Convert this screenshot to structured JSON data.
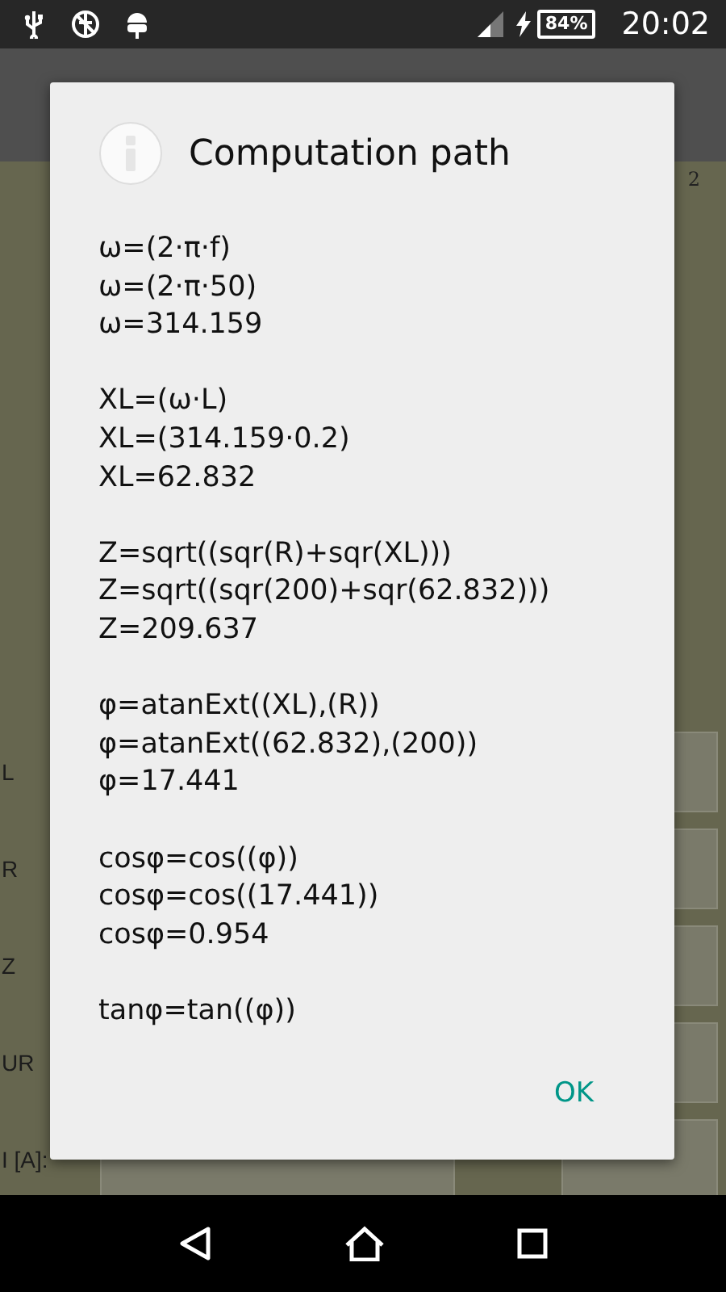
{
  "status_bar": {
    "battery": "84%",
    "time": "20:02"
  },
  "background": {
    "superscript": "2",
    "rows": [
      {
        "label": "L"
      },
      {
        "label": "R"
      },
      {
        "label": "Z"
      },
      {
        "label": "UR"
      },
      {
        "label": "I [A]:"
      }
    ]
  },
  "dialog": {
    "title": "Computation path",
    "groups": [
      [
        "ω=(2·π·f)",
        "ω=(2·π·50)",
        "ω=314.159"
      ],
      [
        "XL=(ω·L)",
        "XL=(314.159·0.2)",
        "XL=62.832"
      ],
      [
        "Z=sqrt((sqr(R)+sqr(XL)))",
        "Z=sqrt((sqr(200)+sqr(62.832)))",
        "Z=209.637"
      ],
      [
        "φ=atanExt((XL),(R))",
        "φ=atanExt((62.832),(200))",
        "φ=17.441"
      ],
      [
        "cosφ=cos((φ))",
        "cosφ=cos((17.441))",
        "cosφ=0.954"
      ],
      [
        "tanφ=tan((φ))"
      ]
    ],
    "button": "OK"
  }
}
